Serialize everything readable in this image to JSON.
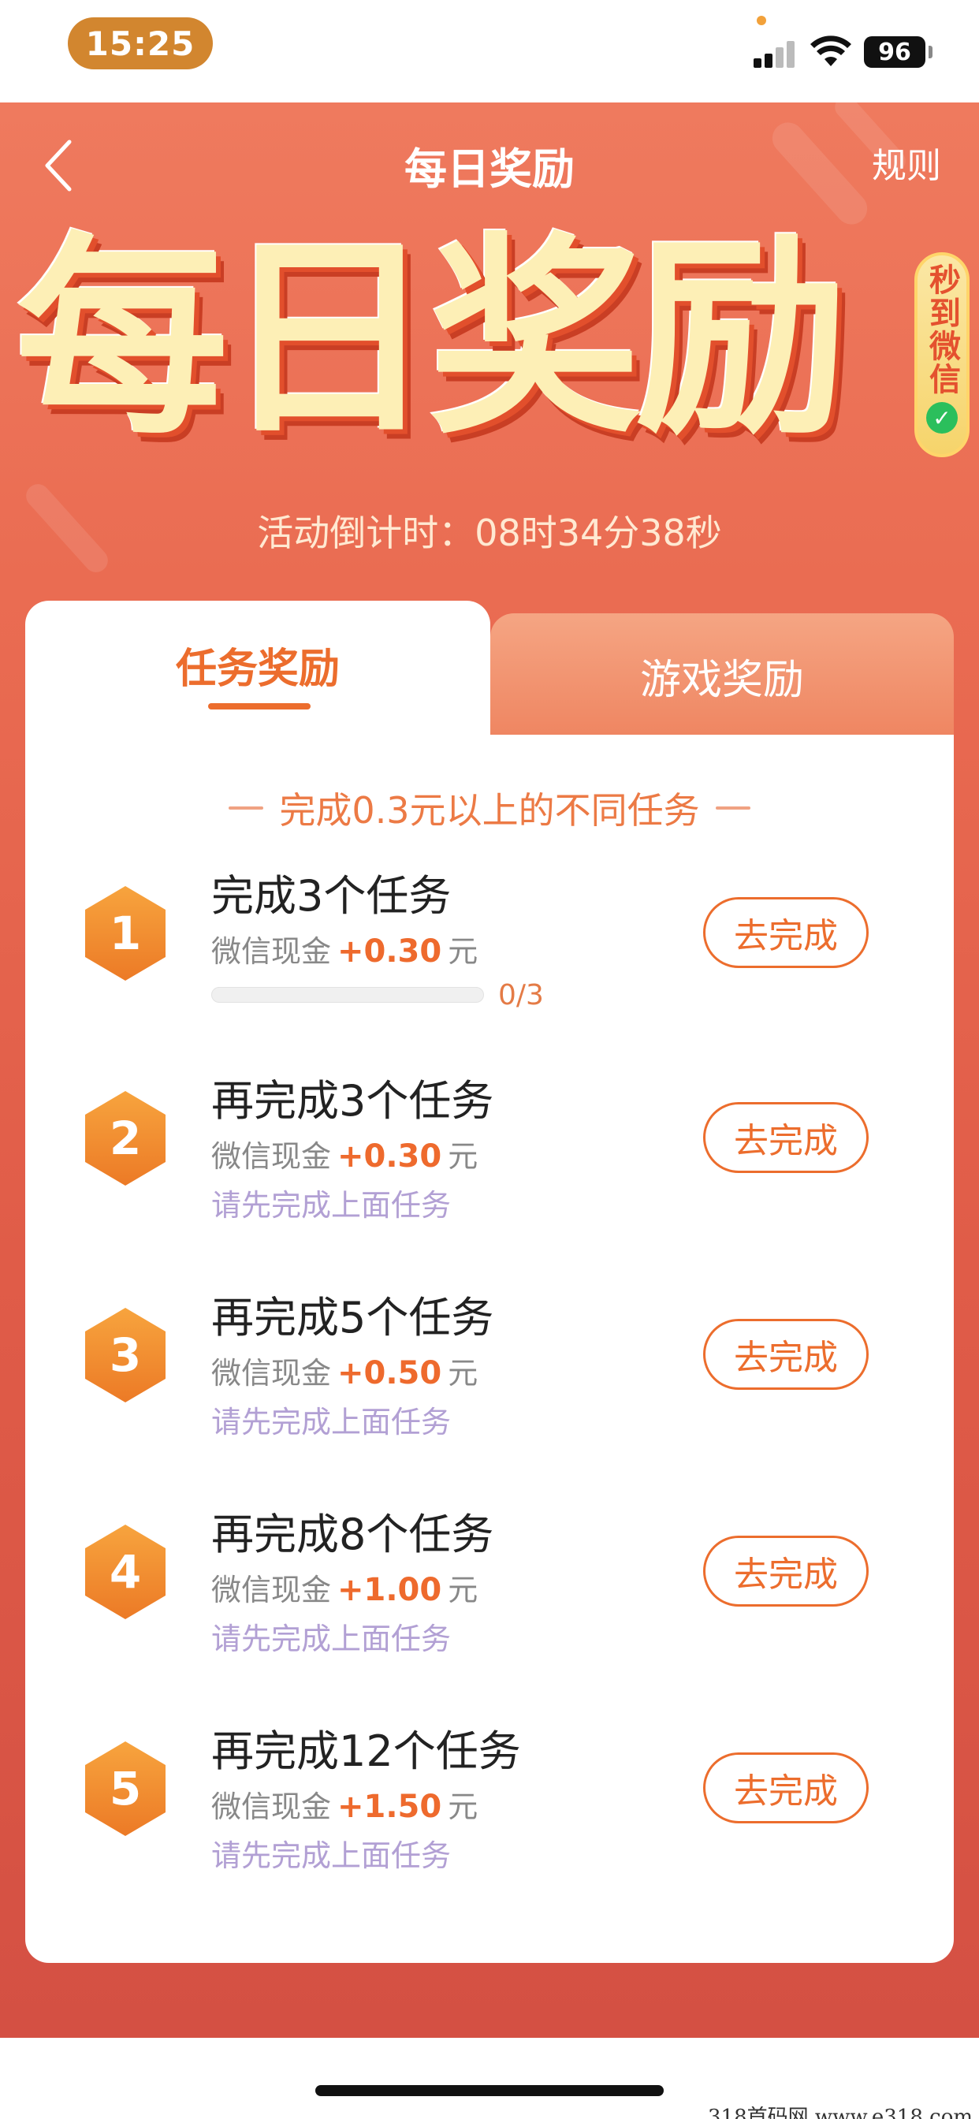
{
  "status_bar": {
    "time": "15:25",
    "battery": "96"
  },
  "nav": {
    "back_icon": "chevron-left-icon",
    "title": "每日奖励",
    "rules": "规则"
  },
  "hero": {
    "big_title": "每日奖励",
    "badge_text": "秒到微信",
    "countdown": "活动倒计时：08时34分38秒"
  },
  "tabs": [
    {
      "label": "任务奖励",
      "active": true
    },
    {
      "label": "游戏奖励",
      "active": false
    }
  ],
  "section_title": "完成0.3元以上的不同任务",
  "tasks": [
    {
      "num": "1",
      "title": "完成3个任务",
      "reward_prefix": "微信现金",
      "amount": "+0.30",
      "unit": "元",
      "progress_text": "0/3",
      "progress": 0,
      "button": "去完成"
    },
    {
      "num": "2",
      "title": "再完成3个任务",
      "reward_prefix": "微信现金",
      "amount": "+0.30",
      "unit": "元",
      "hint": "请先完成上面任务",
      "button": "去完成"
    },
    {
      "num": "3",
      "title": "再完成5个任务",
      "reward_prefix": "微信现金",
      "amount": "+0.50",
      "unit": "元",
      "hint": "请先完成上面任务",
      "button": "去完成"
    },
    {
      "num": "4",
      "title": "再完成8个任务",
      "reward_prefix": "微信现金",
      "amount": "+1.00",
      "unit": "元",
      "hint": "请先完成上面任务",
      "button": "去完成"
    },
    {
      "num": "5",
      "title": "再完成12个任务",
      "reward_prefix": "微信现金",
      "amount": "+1.50",
      "unit": "元",
      "hint": "请先完成上面任务",
      "button": "去完成"
    }
  ],
  "watermark": "318首码网 www.e318.com",
  "colors": {
    "accent": "#ec6d2d",
    "background_top": "#ef7a5e",
    "background_bottom": "#d45043",
    "hint": "#b2a0d4"
  }
}
